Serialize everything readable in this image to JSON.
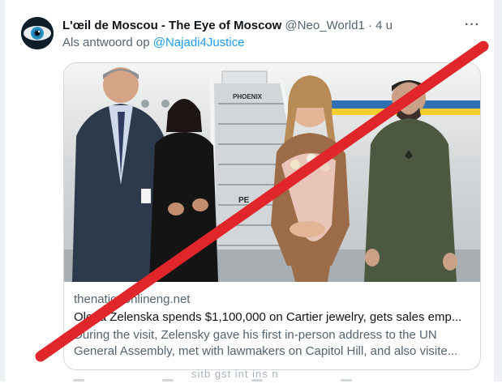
{
  "tweet": {
    "display_name": "L'œil de Moscou - The Eye of Moscow",
    "handle": "@Neo_World1",
    "separator": "·",
    "time": "4 u",
    "more_label": "···",
    "reply_prefix": "Als antwoord op",
    "reply_to": "@Najadi4Justice",
    "avatar_icon": "eye-icon"
  },
  "card": {
    "domain": "thenationonlineng.net",
    "title": "Olena Zelenska spends $1,100,000 on Cartier jewelry, gets sales emp...",
    "description": "During the visit, Zelensky gave his first in-person address to the UN General Assembly, met with lawmakers on Capitol Hill, and also visite...",
    "image_stair_sign_1": "PHOENIX",
    "image_stair_sign_2": "PE"
  },
  "overlay": {
    "caption": "sitb gst int ins n",
    "cross_color": "#e0262b"
  }
}
